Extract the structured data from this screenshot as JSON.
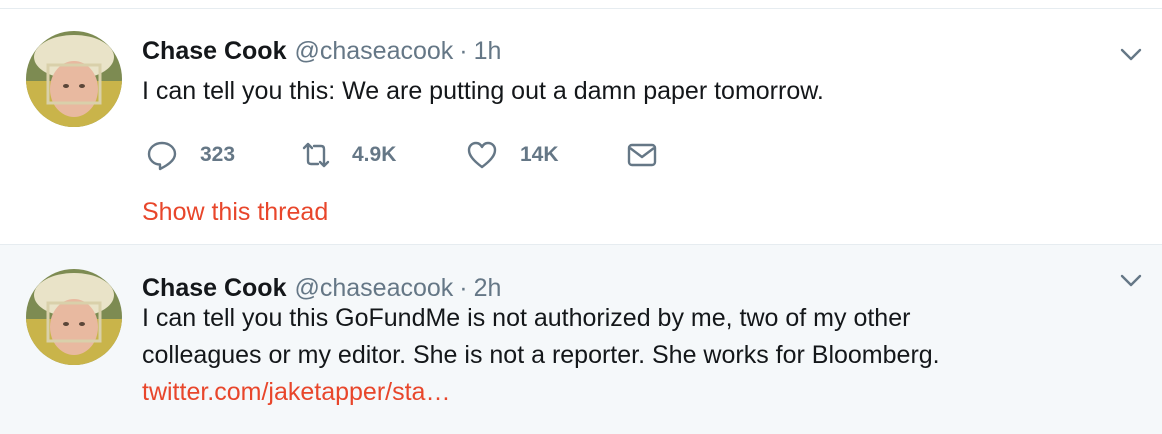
{
  "tweets": [
    {
      "name": "Chase Cook",
      "handle": "@chaseacook",
      "separator": "·",
      "time": "1h",
      "text": "I can tell you this: We are putting out a damn paper tomorrow.",
      "actions": {
        "reply_count": "323",
        "retweet_count": "4.9K",
        "like_count": "14K"
      },
      "show_thread": "Show this thread"
    },
    {
      "name": "Chase Cook",
      "handle": "@chaseacook",
      "separator": "·",
      "time": "2h",
      "text_line1": "I can tell you this GoFundMe is not authorized by me, two of my other",
      "text_line2": "colleagues or my editor. She is not a reporter. She works for Bloomberg.",
      "link": "twitter.com/jaketapper/sta…"
    }
  ],
  "icons": {
    "reply": "reply-icon",
    "retweet": "retweet-icon",
    "like": "heart-icon",
    "dm": "envelope-icon",
    "menu": "chevron-down-icon"
  },
  "colors": {
    "accent": "#e8462b",
    "secondary_text": "#657786",
    "alt_background": "#f5f8fa"
  }
}
